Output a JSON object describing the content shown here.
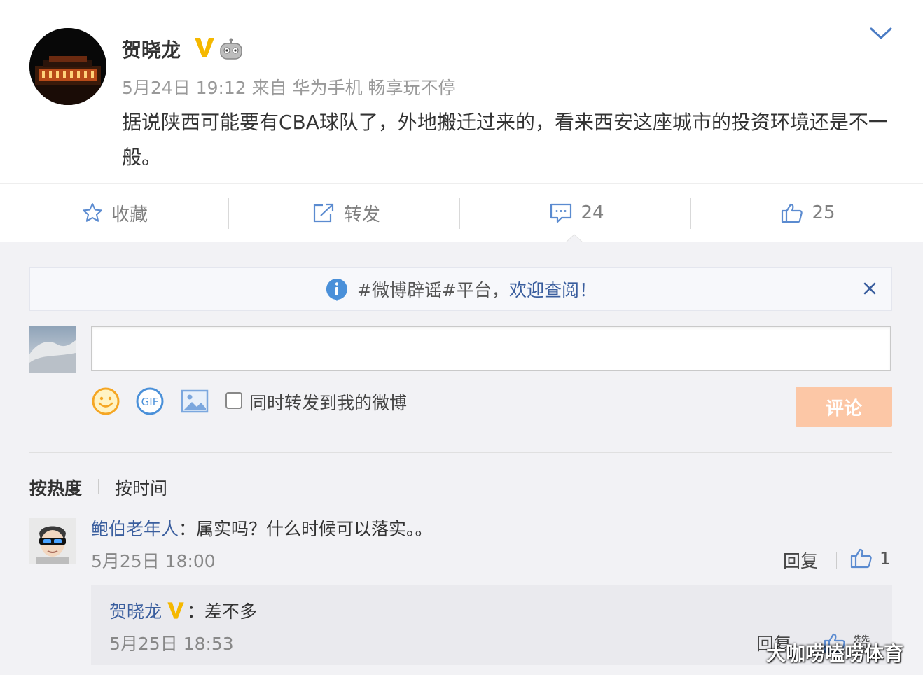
{
  "post": {
    "author": "贺晓龙",
    "meta": "5月24日 19:12 来自 华为手机 畅享玩不停",
    "text": "据说陕西可能要有CBA球队了，外地搬迁过来的，看来西安这座城市的投资环境还是不一般。"
  },
  "actions": {
    "favorite": "收藏",
    "repost": "转发",
    "comment_count": "24",
    "like_count": "25"
  },
  "notice": {
    "prefix": "#微博辟谣#平台，",
    "link": "欢迎查阅！"
  },
  "composer": {
    "input_value": "",
    "repost_checkbox_label": "同时转发到我的微博",
    "submit_label": "评论"
  },
  "sort": {
    "hot": "按热度",
    "time": "按时间"
  },
  "comments": [
    {
      "user": "鲍伯老年人",
      "text": "：属实吗？什么时候可以落实。。",
      "time": "5月25日 18:00",
      "reply_label": "回复",
      "like_count": "1",
      "replies": [
        {
          "user": "贺晓龙",
          "text": "：差不多",
          "time": "5月25日 18:53",
          "reply_label": "回复",
          "like_label": "赞"
        }
      ]
    }
  ],
  "watermark": "大咖唠嗑唠体育",
  "colors": {
    "link": "#3a5e9e",
    "verified": "#f5b800",
    "submit_disabled": "#fcc7a6",
    "info": "#4a90d9"
  }
}
